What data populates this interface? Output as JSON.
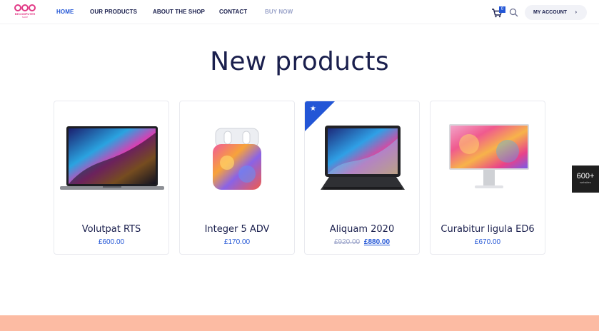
{
  "brand": {
    "logo_line1": "BECOMPUTER",
    "logo_line2": "SHOP",
    "accent": "#2356d6",
    "logo_color": "#e23a87"
  },
  "nav": {
    "items": [
      {
        "label": "HOME",
        "state": "active"
      },
      {
        "label": "OUR PRODUCTS",
        "state": "normal"
      },
      {
        "label": "ABOUT THE SHOP",
        "state": "normal"
      },
      {
        "label": "CONTACT",
        "state": "normal"
      },
      {
        "label": "BUY NOW",
        "state": "muted"
      }
    ]
  },
  "header": {
    "cart_icon": "cart-icon",
    "cart_count": "0",
    "search_icon": "search-icon",
    "account_label": "MY ACCOUNT",
    "account_chevron": "›"
  },
  "main": {
    "title": "New products",
    "products": [
      {
        "name": "Volutpat RTS",
        "price": "£600.00",
        "image": "laptop-image"
      },
      {
        "name": "Integer 5 ADV",
        "price": "£170.00",
        "image": "earbuds-case-image"
      },
      {
        "name": "Aliquam 2020",
        "old_price": "£920.00",
        "price": "£880.00",
        "image": "tablet-keyboard-image",
        "featured_badge": "★"
      },
      {
        "name": "Curabitur ligula ED6",
        "price": "£670.00",
        "image": "monitor-image"
      }
    ]
  },
  "side_widget": {
    "count": "600+",
    "caption": "websites"
  },
  "colors": {
    "text": "#1a1f4d",
    "footer_band": "#fcbba3"
  }
}
